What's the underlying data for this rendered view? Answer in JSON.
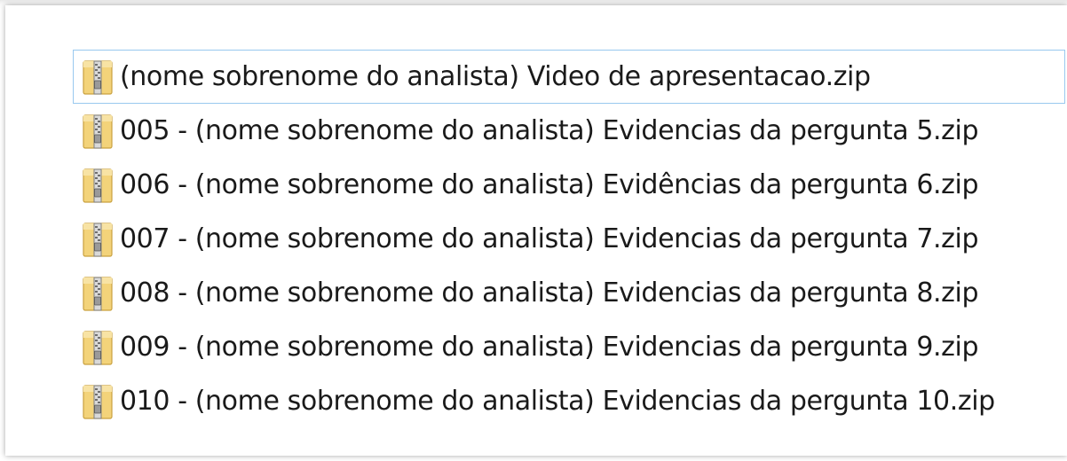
{
  "explorer": {
    "files": [
      {
        "name": "(nome sobrenome do analista) Video de apresentacao.zip",
        "icon": "zip-folder-icon",
        "selected": true
      },
      {
        "name": "005 - (nome sobrenome do analista) Evidencias da pergunta 5.zip",
        "icon": "zip-folder-icon",
        "selected": false
      },
      {
        "name": "006 - (nome sobrenome do analista) Evidências da pergunta 6.zip",
        "icon": "zip-folder-icon",
        "selected": false
      },
      {
        "name": "007 - (nome sobrenome do analista) Evidencias da pergunta 7.zip",
        "icon": "zip-folder-icon",
        "selected": false
      },
      {
        "name": "008 - (nome sobrenome do analista) Evidencias da pergunta 8.zip",
        "icon": "zip-folder-icon",
        "selected": false
      },
      {
        "name": "009 - (nome sobrenome do analista) Evidencias da pergunta 9.zip",
        "icon": "zip-folder-icon",
        "selected": false
      },
      {
        "name": "010 - (nome sobrenome do analista) Evidencias da pergunta 10.zip",
        "icon": "zip-folder-icon",
        "selected": false
      }
    ],
    "colors": {
      "selection_border": "#99c9ef",
      "folder_body": "#f3d37a",
      "zipper": "#8a8a8a"
    }
  }
}
